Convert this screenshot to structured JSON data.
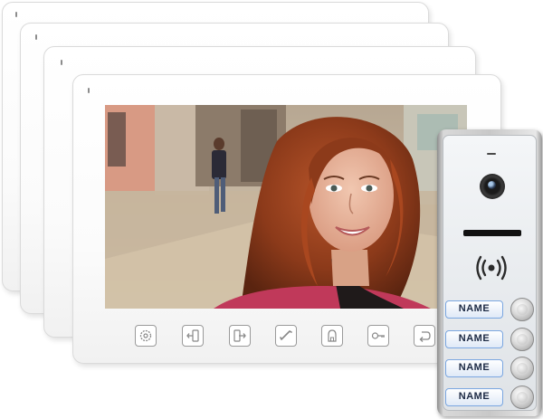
{
  "product": {
    "monitor_buttons": [
      {
        "icon": "settings-icon"
      },
      {
        "icon": "intercom-out-icon"
      },
      {
        "icon": "intercom-in-icon"
      },
      {
        "icon": "phone-handset-icon"
      },
      {
        "icon": "monitor-person-icon"
      },
      {
        "icon": "key-icon"
      },
      {
        "icon": "back-icon"
      }
    ],
    "door_station": {
      "name_labels": [
        "NAME",
        "NAME",
        "NAME",
        "NAME"
      ],
      "rfid_icon": "rfid-wave-icon"
    },
    "colors": {
      "label_border": "#7aa6e0",
      "station_frame": "#c8c8c8",
      "monitor_body": "#ffffff"
    }
  }
}
